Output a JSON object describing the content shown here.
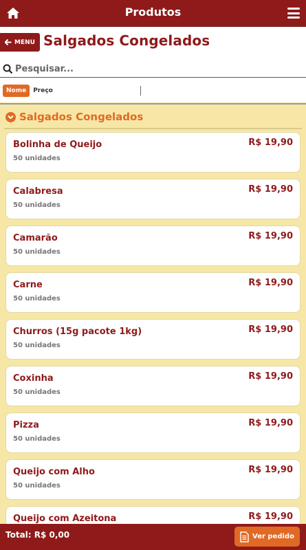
{
  "topbar": {
    "title": "Produtos",
    "home_icon": "home-icon",
    "menu_icon": "hamburger-icon"
  },
  "header": {
    "menu_label": "MENU",
    "page_title": "Salgados Congelados",
    "search_placeholder": "Pesquisar...",
    "sort_options": [
      "Nome",
      "Preço"
    ],
    "sort_active": "Nome"
  },
  "category": {
    "title": "Salgados Congelados"
  },
  "items": [
    {
      "name": "Bolinha de Queijo",
      "sub": "50 unidades",
      "price": "R$ 19,90"
    },
    {
      "name": "Calabresa",
      "sub": "50 unidades",
      "price": "R$ 19,90"
    },
    {
      "name": "Camarão",
      "sub": "50 unidades",
      "price": "R$ 19,90"
    },
    {
      "name": "Carne",
      "sub": "50 unidades",
      "price": "R$ 19,90"
    },
    {
      "name": "Churros (15g pacote 1kg)",
      "sub": "50 unidades",
      "price": "R$ 19,90"
    },
    {
      "name": "Coxinha",
      "sub": "50 unidades",
      "price": "R$ 19,90"
    },
    {
      "name": "Pizza",
      "sub": "50 unidades",
      "price": "R$ 19,90"
    },
    {
      "name": "Queijo com Alho",
      "sub": "50 unidades",
      "price": "R$ 19,90"
    },
    {
      "name": "Queijo com Azeitona",
      "sub": "",
      "price": "R$ 19,90"
    }
  ],
  "footer": {
    "total": "Total: R$ 0,00",
    "ver_pedido": "Ver pedido"
  },
  "colors": {
    "brand": "#8f1a1a",
    "accent": "#e06a25",
    "background": "#f7e7a6"
  }
}
